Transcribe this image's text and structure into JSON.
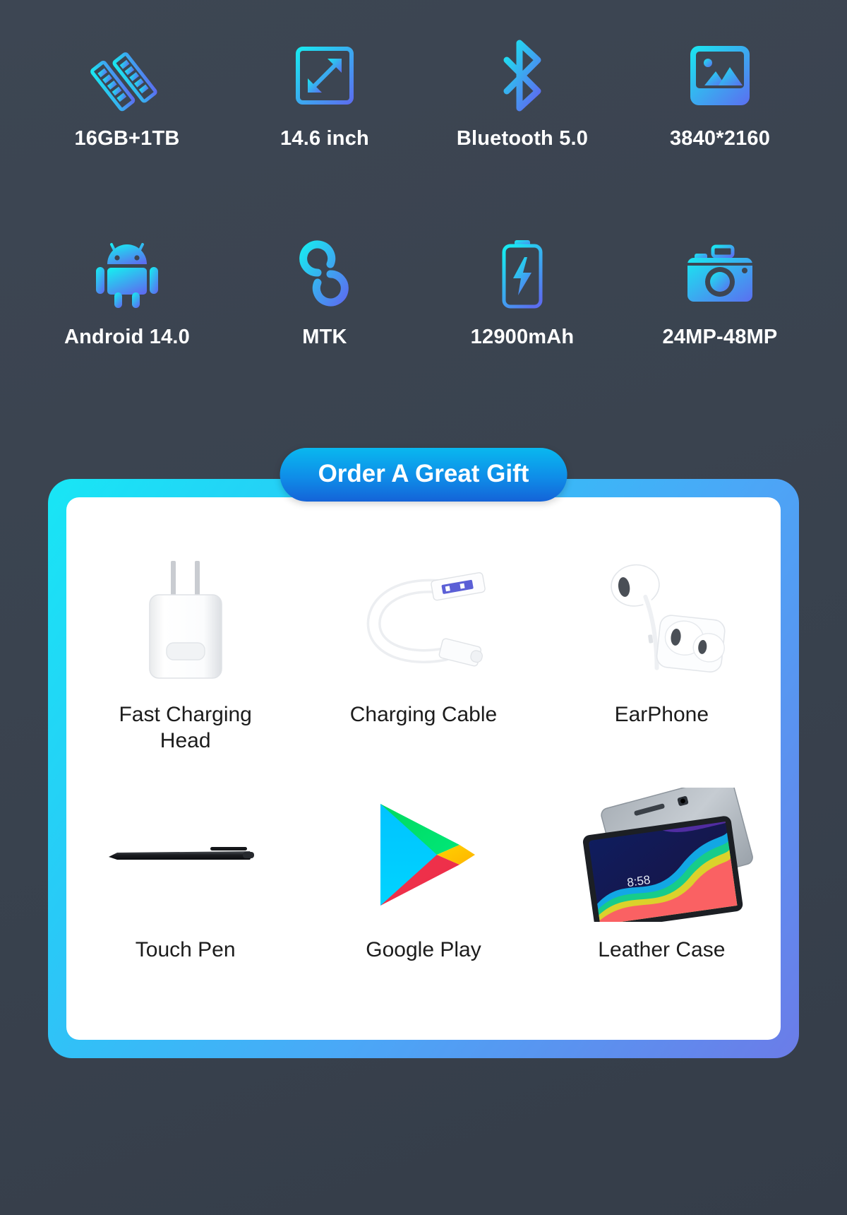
{
  "theme": {
    "background": "#3b4350",
    "icon_gradient_start": "#19e8f0",
    "icon_gradient_end": "#5b6ef0",
    "card_border_start": "#18e6f5",
    "card_border_end": "#6b7ce8",
    "pill_gradient_start": "#09b8ef",
    "pill_gradient_end": "#1463d8",
    "label_light": "#ffffff",
    "label_dark": "#1c1c1c"
  },
  "specs": [
    {
      "label": "16GB+1TB",
      "icon": "ram-sticks-icon"
    },
    {
      "label": "14.6 inch",
      "icon": "screen-size-icon"
    },
    {
      "label": "Bluetooth 5.0",
      "icon": "bluetooth-icon"
    },
    {
      "label": "3840*2160",
      "icon": "image-resolution-icon"
    },
    {
      "label": "Android 14.0",
      "icon": "android-robot-icon"
    },
    {
      "label": "MTK",
      "icon": "mediatek-loop-icon"
    },
    {
      "label": "12900mAh",
      "icon": "battery-charging-icon"
    },
    {
      "label": "24MP-48MP",
      "icon": "camera-icon"
    }
  ],
  "gift": {
    "banner_title": "Order A Great Gift",
    "items": [
      {
        "label": "Fast Charging Head",
        "icon": "wall-charger-icon"
      },
      {
        "label": "Charging Cable",
        "icon": "usb-cable-icon"
      },
      {
        "label": "EarPhone",
        "icon": "earphones-icon"
      },
      {
        "label": "Touch Pen",
        "icon": "stylus-pen-icon"
      },
      {
        "label": "Google Play",
        "icon": "google-play-icon"
      },
      {
        "label": "Leather Case",
        "icon": "tablet-leather-case-icon"
      }
    ],
    "tablet_clock": "8:58"
  }
}
